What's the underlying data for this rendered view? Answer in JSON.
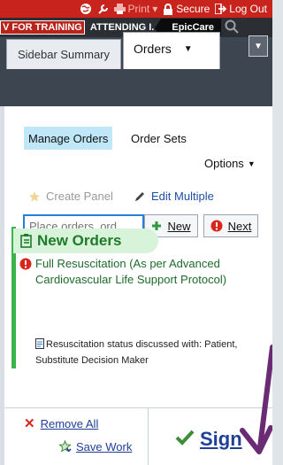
{
  "topbar": {
    "print_label": "Print",
    "secure_label": "Secure",
    "logout_label": "Log Out"
  },
  "envbar": {
    "training_label": "V FOR TRAINING",
    "attending_label": "ATTENDING I.",
    "epic_label": "EpicCare"
  },
  "tabs": {
    "sidebar_summary": "Sidebar Summary",
    "orders": "Orders"
  },
  "panel": {
    "manage_orders": "Manage Orders",
    "order_sets": "Order Sets",
    "options": "Options",
    "create_panel": "Create Panel",
    "edit_multiple": "Edit Multiple",
    "order_placeholder": "Place orders, ord...",
    "new_button": "New",
    "next_button": "Next"
  },
  "new_orders": {
    "header": "New Orders",
    "order_name": "Full Resuscitation (As per Advanced Cardiovascular Life Support Protocol)",
    "note": "Resuscitation status discussed with: Patient, Substitute Decision Maker"
  },
  "footer": {
    "remove_all": "Remove All",
    "save_work": "Save Work",
    "sign": "Sign"
  },
  "colors": {
    "accent_red": "#c8241d",
    "link_blue": "#1f3f99",
    "order_green": "#1e6b2a",
    "arrow_purple": "#6b2a74"
  }
}
